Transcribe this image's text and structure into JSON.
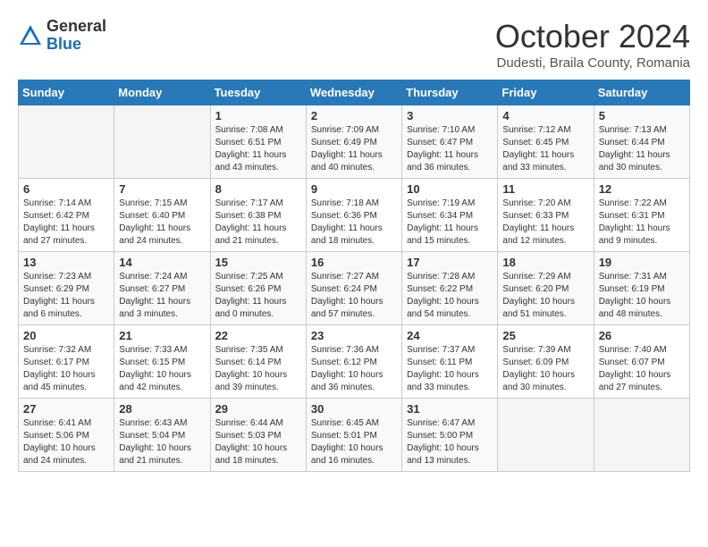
{
  "logo": {
    "general": "General",
    "blue": "Blue"
  },
  "title": "October 2024",
  "subtitle": "Dudesti, Braila County, Romania",
  "days_of_week": [
    "Sunday",
    "Monday",
    "Tuesday",
    "Wednesday",
    "Thursday",
    "Friday",
    "Saturday"
  ],
  "weeks": [
    [
      {
        "day": "",
        "sunrise": "",
        "sunset": "",
        "daylight": ""
      },
      {
        "day": "",
        "sunrise": "",
        "sunset": "",
        "daylight": ""
      },
      {
        "day": "1",
        "sunrise": "Sunrise: 7:08 AM",
        "sunset": "Sunset: 6:51 PM",
        "daylight": "Daylight: 11 hours and 43 minutes."
      },
      {
        "day": "2",
        "sunrise": "Sunrise: 7:09 AM",
        "sunset": "Sunset: 6:49 PM",
        "daylight": "Daylight: 11 hours and 40 minutes."
      },
      {
        "day": "3",
        "sunrise": "Sunrise: 7:10 AM",
        "sunset": "Sunset: 6:47 PM",
        "daylight": "Daylight: 11 hours and 36 minutes."
      },
      {
        "day": "4",
        "sunrise": "Sunrise: 7:12 AM",
        "sunset": "Sunset: 6:45 PM",
        "daylight": "Daylight: 11 hours and 33 minutes."
      },
      {
        "day": "5",
        "sunrise": "Sunrise: 7:13 AM",
        "sunset": "Sunset: 6:44 PM",
        "daylight": "Daylight: 11 hours and 30 minutes."
      }
    ],
    [
      {
        "day": "6",
        "sunrise": "Sunrise: 7:14 AM",
        "sunset": "Sunset: 6:42 PM",
        "daylight": "Daylight: 11 hours and 27 minutes."
      },
      {
        "day": "7",
        "sunrise": "Sunrise: 7:15 AM",
        "sunset": "Sunset: 6:40 PM",
        "daylight": "Daylight: 11 hours and 24 minutes."
      },
      {
        "day": "8",
        "sunrise": "Sunrise: 7:17 AM",
        "sunset": "Sunset: 6:38 PM",
        "daylight": "Daylight: 11 hours and 21 minutes."
      },
      {
        "day": "9",
        "sunrise": "Sunrise: 7:18 AM",
        "sunset": "Sunset: 6:36 PM",
        "daylight": "Daylight: 11 hours and 18 minutes."
      },
      {
        "day": "10",
        "sunrise": "Sunrise: 7:19 AM",
        "sunset": "Sunset: 6:34 PM",
        "daylight": "Daylight: 11 hours and 15 minutes."
      },
      {
        "day": "11",
        "sunrise": "Sunrise: 7:20 AM",
        "sunset": "Sunset: 6:33 PM",
        "daylight": "Daylight: 11 hours and 12 minutes."
      },
      {
        "day": "12",
        "sunrise": "Sunrise: 7:22 AM",
        "sunset": "Sunset: 6:31 PM",
        "daylight": "Daylight: 11 hours and 9 minutes."
      }
    ],
    [
      {
        "day": "13",
        "sunrise": "Sunrise: 7:23 AM",
        "sunset": "Sunset: 6:29 PM",
        "daylight": "Daylight: 11 hours and 6 minutes."
      },
      {
        "day": "14",
        "sunrise": "Sunrise: 7:24 AM",
        "sunset": "Sunset: 6:27 PM",
        "daylight": "Daylight: 11 hours and 3 minutes."
      },
      {
        "day": "15",
        "sunrise": "Sunrise: 7:25 AM",
        "sunset": "Sunset: 6:26 PM",
        "daylight": "Daylight: 11 hours and 0 minutes."
      },
      {
        "day": "16",
        "sunrise": "Sunrise: 7:27 AM",
        "sunset": "Sunset: 6:24 PM",
        "daylight": "Daylight: 10 hours and 57 minutes."
      },
      {
        "day": "17",
        "sunrise": "Sunrise: 7:28 AM",
        "sunset": "Sunset: 6:22 PM",
        "daylight": "Daylight: 10 hours and 54 minutes."
      },
      {
        "day": "18",
        "sunrise": "Sunrise: 7:29 AM",
        "sunset": "Sunset: 6:20 PM",
        "daylight": "Daylight: 10 hours and 51 minutes."
      },
      {
        "day": "19",
        "sunrise": "Sunrise: 7:31 AM",
        "sunset": "Sunset: 6:19 PM",
        "daylight": "Daylight: 10 hours and 48 minutes."
      }
    ],
    [
      {
        "day": "20",
        "sunrise": "Sunrise: 7:32 AM",
        "sunset": "Sunset: 6:17 PM",
        "daylight": "Daylight: 10 hours and 45 minutes."
      },
      {
        "day": "21",
        "sunrise": "Sunrise: 7:33 AM",
        "sunset": "Sunset: 6:15 PM",
        "daylight": "Daylight: 10 hours and 42 minutes."
      },
      {
        "day": "22",
        "sunrise": "Sunrise: 7:35 AM",
        "sunset": "Sunset: 6:14 PM",
        "daylight": "Daylight: 10 hours and 39 minutes."
      },
      {
        "day": "23",
        "sunrise": "Sunrise: 7:36 AM",
        "sunset": "Sunset: 6:12 PM",
        "daylight": "Daylight: 10 hours and 36 minutes."
      },
      {
        "day": "24",
        "sunrise": "Sunrise: 7:37 AM",
        "sunset": "Sunset: 6:11 PM",
        "daylight": "Daylight: 10 hours and 33 minutes."
      },
      {
        "day": "25",
        "sunrise": "Sunrise: 7:39 AM",
        "sunset": "Sunset: 6:09 PM",
        "daylight": "Daylight: 10 hours and 30 minutes."
      },
      {
        "day": "26",
        "sunrise": "Sunrise: 7:40 AM",
        "sunset": "Sunset: 6:07 PM",
        "daylight": "Daylight: 10 hours and 27 minutes."
      }
    ],
    [
      {
        "day": "27",
        "sunrise": "Sunrise: 6:41 AM",
        "sunset": "Sunset: 5:06 PM",
        "daylight": "Daylight: 10 hours and 24 minutes."
      },
      {
        "day": "28",
        "sunrise": "Sunrise: 6:43 AM",
        "sunset": "Sunset: 5:04 PM",
        "daylight": "Daylight: 10 hours and 21 minutes."
      },
      {
        "day": "29",
        "sunrise": "Sunrise: 6:44 AM",
        "sunset": "Sunset: 5:03 PM",
        "daylight": "Daylight: 10 hours and 18 minutes."
      },
      {
        "day": "30",
        "sunrise": "Sunrise: 6:45 AM",
        "sunset": "Sunset: 5:01 PM",
        "daylight": "Daylight: 10 hours and 16 minutes."
      },
      {
        "day": "31",
        "sunrise": "Sunrise: 6:47 AM",
        "sunset": "Sunset: 5:00 PM",
        "daylight": "Daylight: 10 hours and 13 minutes."
      },
      {
        "day": "",
        "sunrise": "",
        "sunset": "",
        "daylight": ""
      },
      {
        "day": "",
        "sunrise": "",
        "sunset": "",
        "daylight": ""
      }
    ]
  ]
}
